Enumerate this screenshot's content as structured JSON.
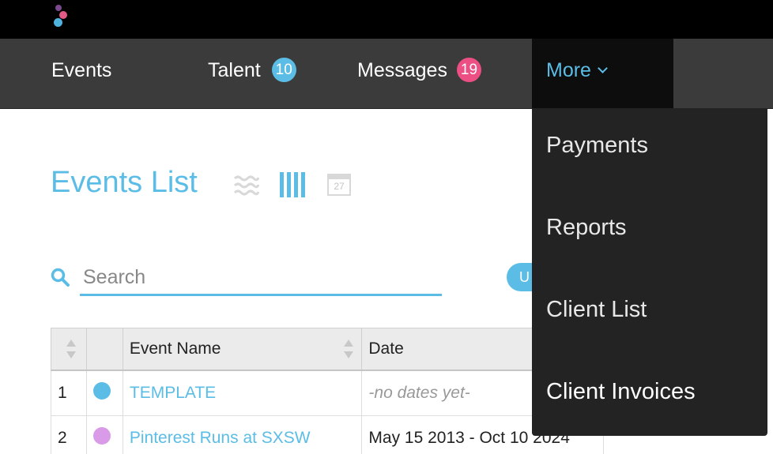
{
  "nav": {
    "events": "Events",
    "talent": "Talent",
    "talent_badge": "10",
    "messages": "Messages",
    "messages_badge": "19",
    "more": "More"
  },
  "colors": {
    "accent": "#5bbde6",
    "talent_badge": "#5bbde6",
    "messages_badge": "#ec4f83",
    "navbar_bg": "#3b3b3b",
    "topbar_bg": "#000000",
    "dropdown_bg": "#232323"
  },
  "page": {
    "title": "Events List",
    "calendar_icon_day": "27"
  },
  "search": {
    "placeholder": "Search",
    "value": "",
    "pill_label": "U"
  },
  "table": {
    "columns": [
      "",
      "",
      "Event Name",
      "Date"
    ],
    "rows": [
      {
        "num": "1",
        "dot_color": "#5bbde6",
        "name": "TEMPLATE",
        "date": "-no dates yet-"
      },
      {
        "num": "2",
        "dot_color": "#d99be8",
        "name": "Pinterest Runs at SXSW",
        "date": "May 15 2013 - Oct 10 2024"
      }
    ]
  },
  "more_menu": {
    "items": [
      "Payments",
      "Reports",
      "Client List",
      "Client Invoices"
    ]
  }
}
